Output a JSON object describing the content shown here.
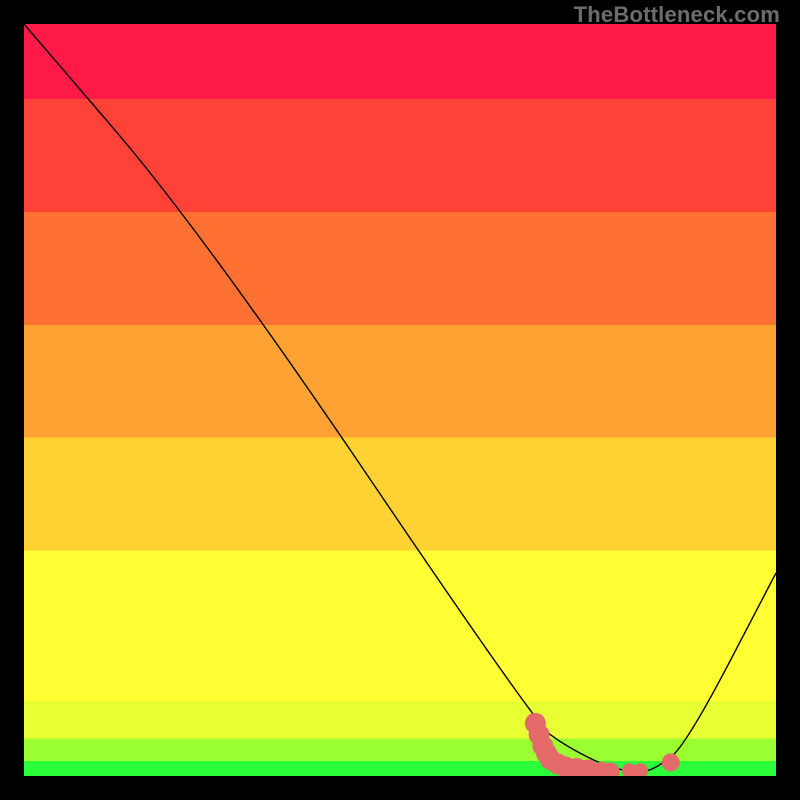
{
  "watermark": "TheBottleneck.com",
  "chart_data": {
    "type": "line",
    "title": "",
    "xlabel": "",
    "ylabel": "",
    "xlim": [
      0,
      100
    ],
    "ylim": [
      0,
      100
    ],
    "series": [
      {
        "name": "curve",
        "x": [
          0,
          24,
          68,
          72,
          78,
          82,
          84,
          88,
          100
        ],
        "values": [
          100,
          72,
          7,
          4,
          1,
          0.5,
          1,
          4,
          27
        ]
      }
    ],
    "markers": {
      "name": "red-dots",
      "points": [
        {
          "x": 68,
          "y": 7,
          "r": 1.4
        },
        {
          "x": 68.5,
          "y": 5.5,
          "r": 1.4
        },
        {
          "x": 69,
          "y": 4,
          "r": 1.4
        },
        {
          "x": 69.5,
          "y": 3,
          "r": 1.4
        },
        {
          "x": 70,
          "y": 2.2,
          "r": 1.4
        },
        {
          "x": 71,
          "y": 1.6,
          "r": 1.4
        },
        {
          "x": 72,
          "y": 1.2,
          "r": 1.4
        },
        {
          "x": 73.5,
          "y": 1.0,
          "r": 1.4
        },
        {
          "x": 75,
          "y": 0.8,
          "r": 1.4
        },
        {
          "x": 76.8,
          "y": 0.7,
          "r": 1.2
        },
        {
          "x": 78,
          "y": 0.6,
          "r": 1.2
        },
        {
          "x": 80.5,
          "y": 0.7,
          "r": 1.0
        },
        {
          "x": 82,
          "y": 0.7,
          "r": 1.0
        },
        {
          "x": 86,
          "y": 1.8,
          "r": 1.2
        }
      ],
      "color": "#e46a6a"
    },
    "bands": [
      {
        "name": "green-band",
        "y0": 0,
        "y1": 2,
        "color": "#2bff3a"
      },
      {
        "name": "lime-band",
        "y0": 2,
        "y1": 5,
        "color": "#9bff31"
      },
      {
        "name": "yellow2",
        "y0": 5,
        "y1": 10,
        "color": "#e8ff34"
      },
      {
        "name": "yellow1",
        "y0": 10,
        "y1": 30,
        "color": "#ffff33"
      },
      {
        "name": "amber",
        "y0": 30,
        "y1": 45,
        "color": "#ffd233"
      },
      {
        "name": "orange",
        "y0": 45,
        "y1": 60,
        "color": "#ffa233"
      },
      {
        "name": "dark-orange",
        "y0": 60,
        "y1": 75,
        "color": "#ff7033"
      },
      {
        "name": "red-orange",
        "y0": 75,
        "y1": 90,
        "color": "#ff4238"
      },
      {
        "name": "red",
        "y0": 90,
        "y1": 100,
        "color": "#ff1a48"
      }
    ],
    "legend": null,
    "grid": false
  }
}
